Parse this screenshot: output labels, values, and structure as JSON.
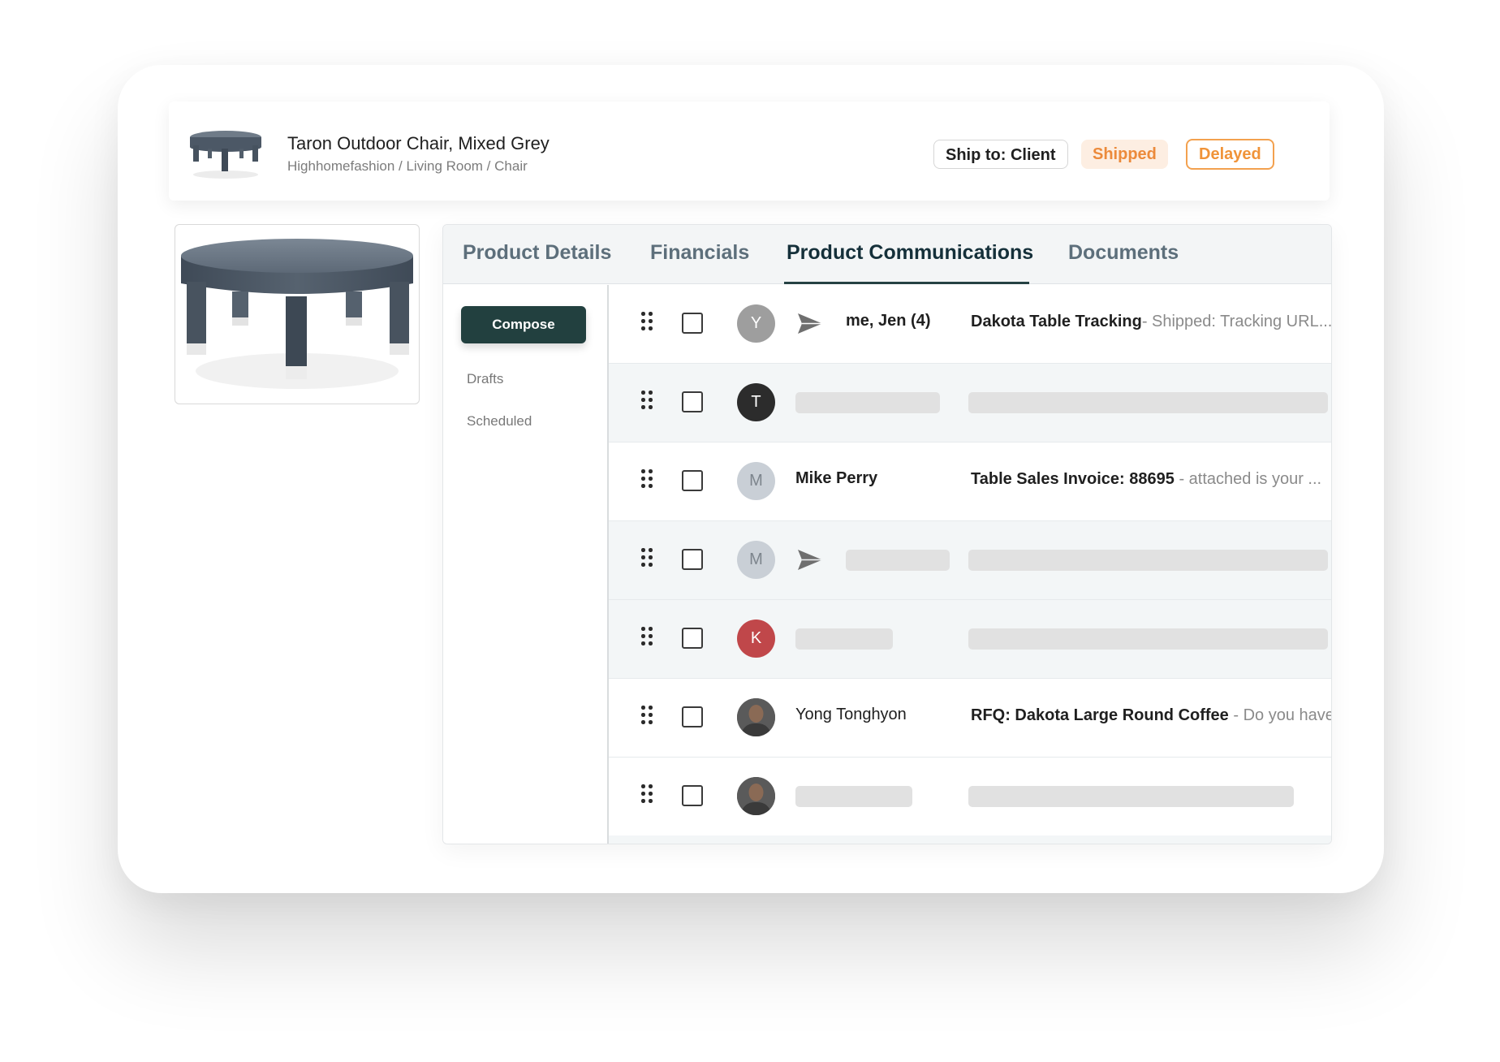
{
  "header": {
    "product_title": "Taron Outdoor Chair, Mixed Grey",
    "breadcrumb": "Highhomefashion / Living Room / Chair",
    "chips": {
      "ship_to": "Ship to: Client",
      "shipped": "Shipped",
      "delayed": "Delayed"
    }
  },
  "tabs": [
    {
      "label": "Product Details"
    },
    {
      "label": "Financials"
    },
    {
      "label": "Product Communications",
      "active": true
    },
    {
      "label": "Documents"
    }
  ],
  "sidebar": {
    "compose_label": "Compose",
    "links": [
      "Drafts",
      "Scheduled"
    ]
  },
  "messages": [
    {
      "avatar_letter": "Y",
      "avatar_color": "#9e9e9e",
      "sent": true,
      "sender": "me, Jen (4)",
      "subject": "Dakota Table Tracking",
      "preview": "- Shipped: Tracking URL..."
    },
    {
      "avatar_letter": "T",
      "avatar_color": "#2c2c2c",
      "sent": false,
      "sender": "",
      "subject": "",
      "preview": ""
    },
    {
      "avatar_letter": "M",
      "avatar_color": "#c9cfd6",
      "sent": false,
      "sender": "Mike Perry",
      "subject": "Table Sales Invoice: 88695",
      "preview": " - attached is your ..."
    },
    {
      "avatar_letter": "M",
      "avatar_color": "#c9cfd6",
      "sent": true,
      "sender": "",
      "subject": "",
      "preview": ""
    },
    {
      "avatar_letter": "K",
      "avatar_color": "#c0474a",
      "sent": false,
      "sender": "",
      "subject": "",
      "preview": ""
    },
    {
      "avatar_letter": "",
      "avatar_color": "#4a4a4a",
      "sent": false,
      "sender": "Yong Tonghyon",
      "subject": "RFQ: Dakota Large Round Coffee",
      "preview": " - Do you have a"
    },
    {
      "avatar_letter": "",
      "avatar_color": "#4a4a4a",
      "sent": false,
      "sender": "",
      "subject": "",
      "preview": ""
    }
  ],
  "colors": {
    "accent": "#22403f",
    "shipped_text": "#ec8a3b",
    "shipped_bg": "#fdeee2",
    "delayed": "#f09338"
  }
}
